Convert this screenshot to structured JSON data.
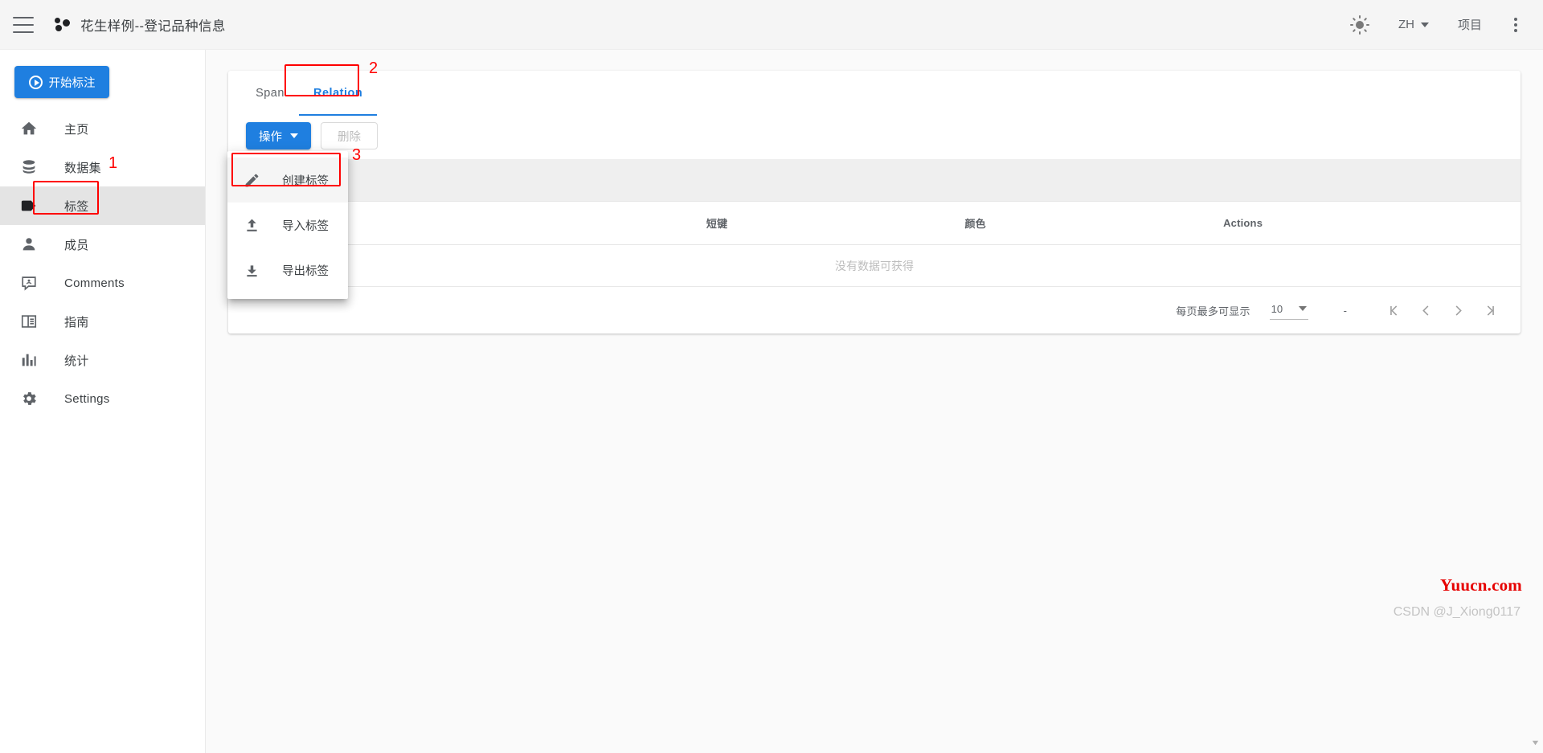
{
  "header": {
    "menu_icon": "hamburger-icon",
    "brand_icon": "doccano-logo-icon",
    "title": "花生样例--登记品种信息",
    "theme_icon": "sun-icon",
    "language": "ZH",
    "project_label": "项目",
    "more_icon": "kebab-menu-icon"
  },
  "sidebar": {
    "start_button": "开始标注",
    "items": [
      {
        "icon": "home-icon",
        "label": "主页"
      },
      {
        "icon": "database-icon",
        "label": "数据集"
      },
      {
        "icon": "tag-icon",
        "label": "标签"
      },
      {
        "icon": "person-icon",
        "label": "成员"
      },
      {
        "icon": "comment-icon",
        "label": "Comments"
      },
      {
        "icon": "book-icon",
        "label": "指南"
      },
      {
        "icon": "chart-icon",
        "label": "统计"
      },
      {
        "icon": "gear-icon",
        "label": "Settings"
      }
    ],
    "active_index": 2
  },
  "main": {
    "tabs": [
      {
        "label": "Span",
        "active": false
      },
      {
        "label": "Relation",
        "active": true
      }
    ],
    "toolbar": {
      "action_label": "操作",
      "delete_label": "删除"
    },
    "dropdown": {
      "items": [
        {
          "icon": "pencil-icon",
          "label": "创建标签",
          "highlighted": true
        },
        {
          "icon": "upload-icon",
          "label": "导入标签",
          "highlighted": false
        },
        {
          "icon": "download-icon",
          "label": "导出标签",
          "highlighted": false
        }
      ]
    },
    "table": {
      "columns": [
        {
          "label": "",
          "key": "name"
        },
        {
          "label": "短键",
          "key": "shortcut"
        },
        {
          "label": "颜色",
          "key": "color"
        },
        {
          "label": "Actions",
          "key": "actions"
        }
      ],
      "rows": [],
      "empty_text": "没有数据可获得"
    },
    "pagination": {
      "rows_per_page_label": "每页最多可显示",
      "rows_per_page_value": "10",
      "range_text": "-",
      "first_icon": "first-page-icon",
      "prev_icon": "prev-page-icon",
      "next_icon": "next-page-icon",
      "last_icon": "last-page-icon"
    }
  },
  "annotations": [
    {
      "number": "1"
    },
    {
      "number": "2"
    },
    {
      "number": "3"
    }
  ],
  "watermarks": {
    "red": "Yuucn.com",
    "gray": "CSDN @J_Xiong0117"
  },
  "colors": {
    "accent": "#1f7fe0",
    "annotation": "#ff0000",
    "watermark_red": "#e60000",
    "band": "#efefef"
  }
}
